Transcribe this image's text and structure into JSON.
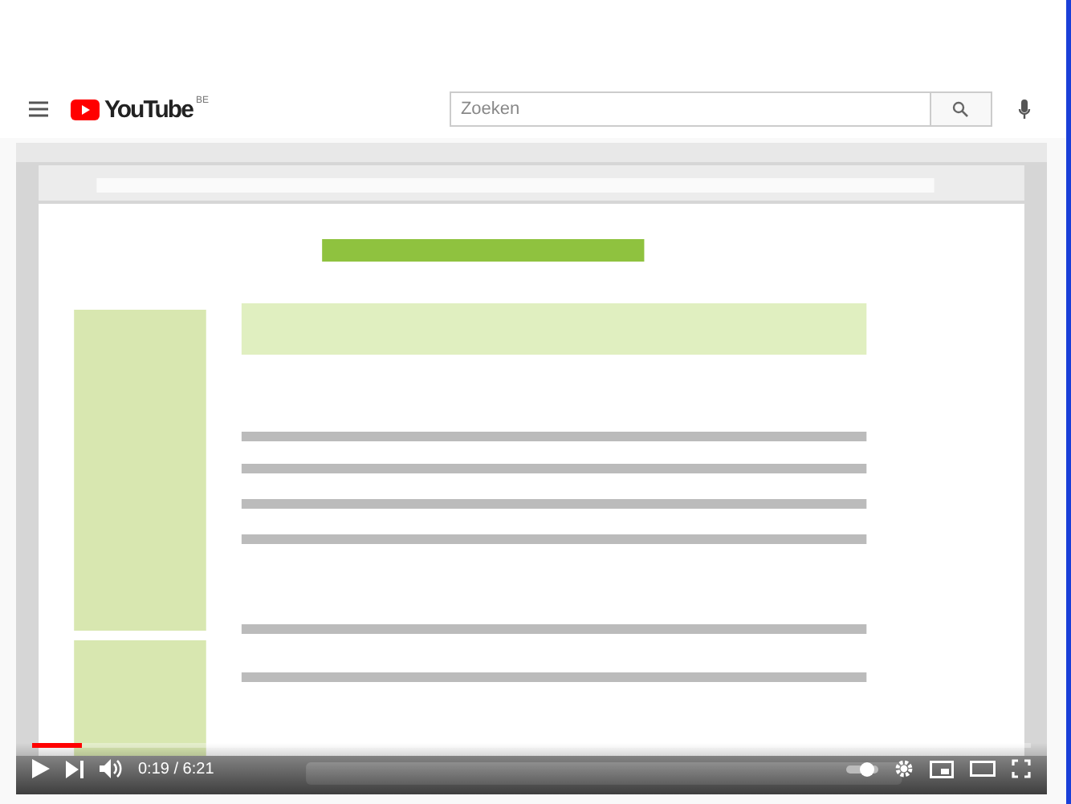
{
  "header": {
    "logo": "YouTube",
    "region": "BE",
    "search": {
      "placeholder": "Zoeken"
    }
  },
  "player": {
    "progress": {
      "level": 0.05
    },
    "time": "0:19 / 6:21"
  }
}
